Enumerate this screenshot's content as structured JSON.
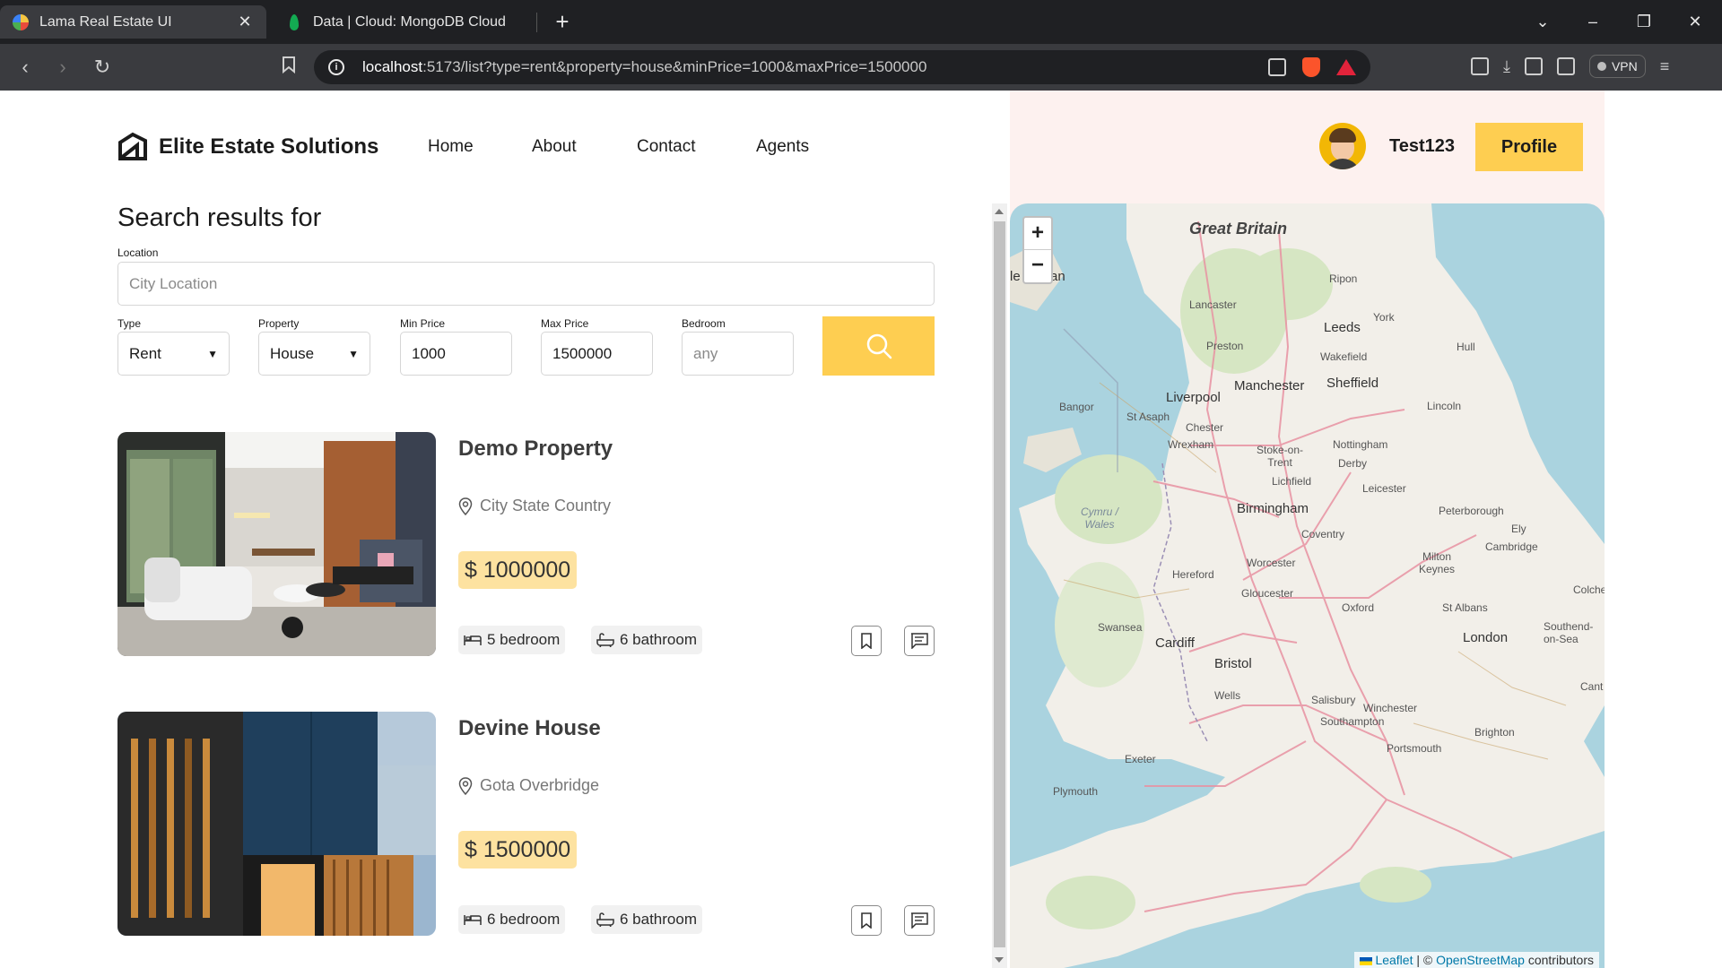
{
  "browser": {
    "tabs": [
      {
        "title": "Lama Real Estate UI",
        "active": true
      },
      {
        "title": "Data | Cloud: MongoDB Cloud",
        "active": false
      }
    ],
    "url_host": "localhost",
    "url_path": ":5173/list?type=rent&property=house&minPrice=1000&maxPrice=1500000",
    "vpn_label": "VPN"
  },
  "header": {
    "brand": "Elite Estate Solutions",
    "nav": [
      "Home",
      "About",
      "Contact",
      "Agents"
    ],
    "username": "Test123",
    "profile_label": "Profile"
  },
  "search": {
    "title": "Search results for",
    "location_label": "Location",
    "location_placeholder": "City Location",
    "type_label": "Type",
    "type_value": "Rent",
    "property_label": "Property",
    "property_value": "House",
    "min_label": "Min Price",
    "min_value": "1000",
    "max_label": "Max Price",
    "max_value": "1500000",
    "bedroom_label": "Bedroom",
    "bedroom_placeholder": "any"
  },
  "listings": [
    {
      "title": "Demo Property",
      "address": "City State Country",
      "price": "$ 1000000",
      "bedroom": "5 bedroom",
      "bathroom": "6 bathroom"
    },
    {
      "title": "Devine House",
      "address": "Gota Overbridge",
      "price": "$ 1500000",
      "bedroom": "6 bedroom",
      "bathroom": "6 bathroom"
    }
  ],
  "map": {
    "attribution_leaflet": "Leaflet",
    "attribution_sep": "| ©",
    "attribution_osm": "OpenStreetMap",
    "attribution_tail": "contributors",
    "labels": {
      "great_britain": "Great Britain",
      "isle_of_man": "le of Man",
      "ripon": "Ripon",
      "lancaster": "Lancaster",
      "york": "York",
      "leeds": "Leeds",
      "preston": "Preston",
      "wakefield": "Wakefield",
      "hull": "Hull",
      "manchester": "Manchester",
      "sheffield": "Sheffield",
      "liverpool": "Liverpool",
      "bangor": "Bangor",
      "st_asaph": "St Asaph",
      "lincoln": "Lincoln",
      "chester": "Chester",
      "wrexham": "Wrexham",
      "stoke": "Stoke-on-Trent",
      "nottingham": "Nottingham",
      "derby": "Derby",
      "lichfield": "Lichfield",
      "leicester": "Leicester",
      "cymru": "Cymru / Wales",
      "birmingham": "Birmingham",
      "peterborough": "Peterborough",
      "coventry": "Coventry",
      "ely": "Ely",
      "cambridge": "Cambridge",
      "worcester": "Worcester",
      "hereford": "Hereford",
      "milton_keynes": "Milton Keynes",
      "gloucester": "Gloucester",
      "colchester": "Colches",
      "oxford": "Oxford",
      "st_albans": "St Albans",
      "swansea": "Swansea",
      "cardiff": "Cardiff",
      "london": "London",
      "southend": "Southend-on-Sea",
      "bristol": "Bristol",
      "cant": "Cant",
      "wells": "Wells",
      "salisbury": "Salisbury",
      "winchester": "Winchester",
      "southampton": "Southampton",
      "brighton": "Brighton",
      "portsmouth": "Portsmouth",
      "exeter": "Exeter",
      "plymouth": "Plymouth"
    }
  },
  "colors": {
    "accent": "#fece51",
    "price_bg": "#fde2a0",
    "right_panel": "#fdf1ef",
    "sea": "#aad3df",
    "land": "#f2efe9"
  }
}
